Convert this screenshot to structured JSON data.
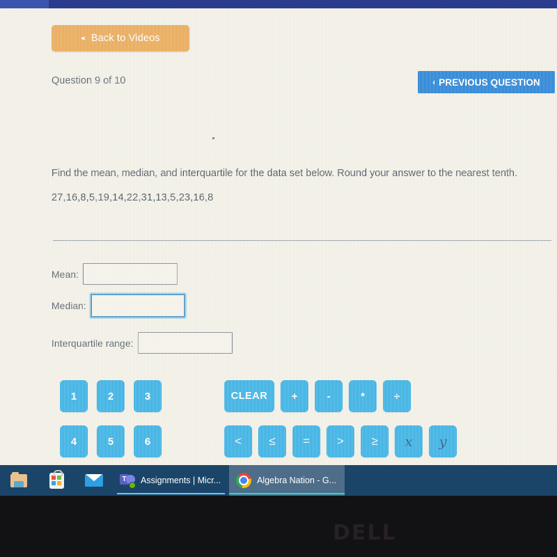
{
  "browser": {
    "chrome_bar_color": "#2b3c8f"
  },
  "page": {
    "back_button": {
      "label": "Back to Videos",
      "caret": "◂",
      "color": "#e8a34a"
    },
    "question_counter": "Question 9 of 10",
    "previous_button": {
      "label": "PREVIOUS QUESTION",
      "caret": "‹",
      "color": "#1779d3"
    },
    "prompt": "Find the mean, median, and interquartile for the data set below. Round your answer to the nearest tenth.",
    "dataset": "27,16,8,5,19,14,22,31,13,5,23,16,8",
    "answers": [
      {
        "label": "Mean:",
        "value": "",
        "placeholder": "",
        "focused": false
      },
      {
        "label": "Median:",
        "value": "",
        "placeholder": "",
        "focused": true
      },
      {
        "label": "Interquartile range:",
        "value": "",
        "placeholder": "",
        "focused": false
      }
    ]
  },
  "keypad": {
    "accent_color": "#29abe2",
    "numbers": [
      "1",
      "2",
      "3",
      "4",
      "5",
      "6"
    ],
    "operators_row": [
      {
        "name": "clear",
        "label": "CLEAR"
      },
      {
        "name": "plus",
        "label": "+"
      },
      {
        "name": "minus",
        "label": "-"
      },
      {
        "name": "multiply",
        "label": "*"
      },
      {
        "name": "divide",
        "label": "÷"
      }
    ],
    "comparisons_row": [
      {
        "name": "less-than",
        "label": "<"
      },
      {
        "name": "less-than-or-equal",
        "label": "≤"
      },
      {
        "name": "equals",
        "label": "="
      },
      {
        "name": "greater-than",
        "label": ">"
      },
      {
        "name": "greater-than-or-equal",
        "label": "≥"
      },
      {
        "name": "variable-x",
        "label": "x"
      },
      {
        "name": "variable-y",
        "label": "y"
      }
    ]
  },
  "taskbar": {
    "background": "#1b4568",
    "pinned_icons": [
      {
        "name": "file-explorer-icon",
        "label": "File Explorer"
      },
      {
        "name": "microsoft-store-icon",
        "label": "Microsoft Store"
      },
      {
        "name": "mail-icon",
        "label": "Mail"
      }
    ],
    "windows": [
      {
        "name": "teams-window",
        "icon": "teams-icon",
        "label": "Assignments | Micr...",
        "active": false,
        "badge": "T"
      },
      {
        "name": "chrome-window",
        "icon": "chrome-icon",
        "label": "Algebra Nation - G...",
        "active": true
      }
    ]
  },
  "monitor": {
    "brand": "DELL"
  }
}
